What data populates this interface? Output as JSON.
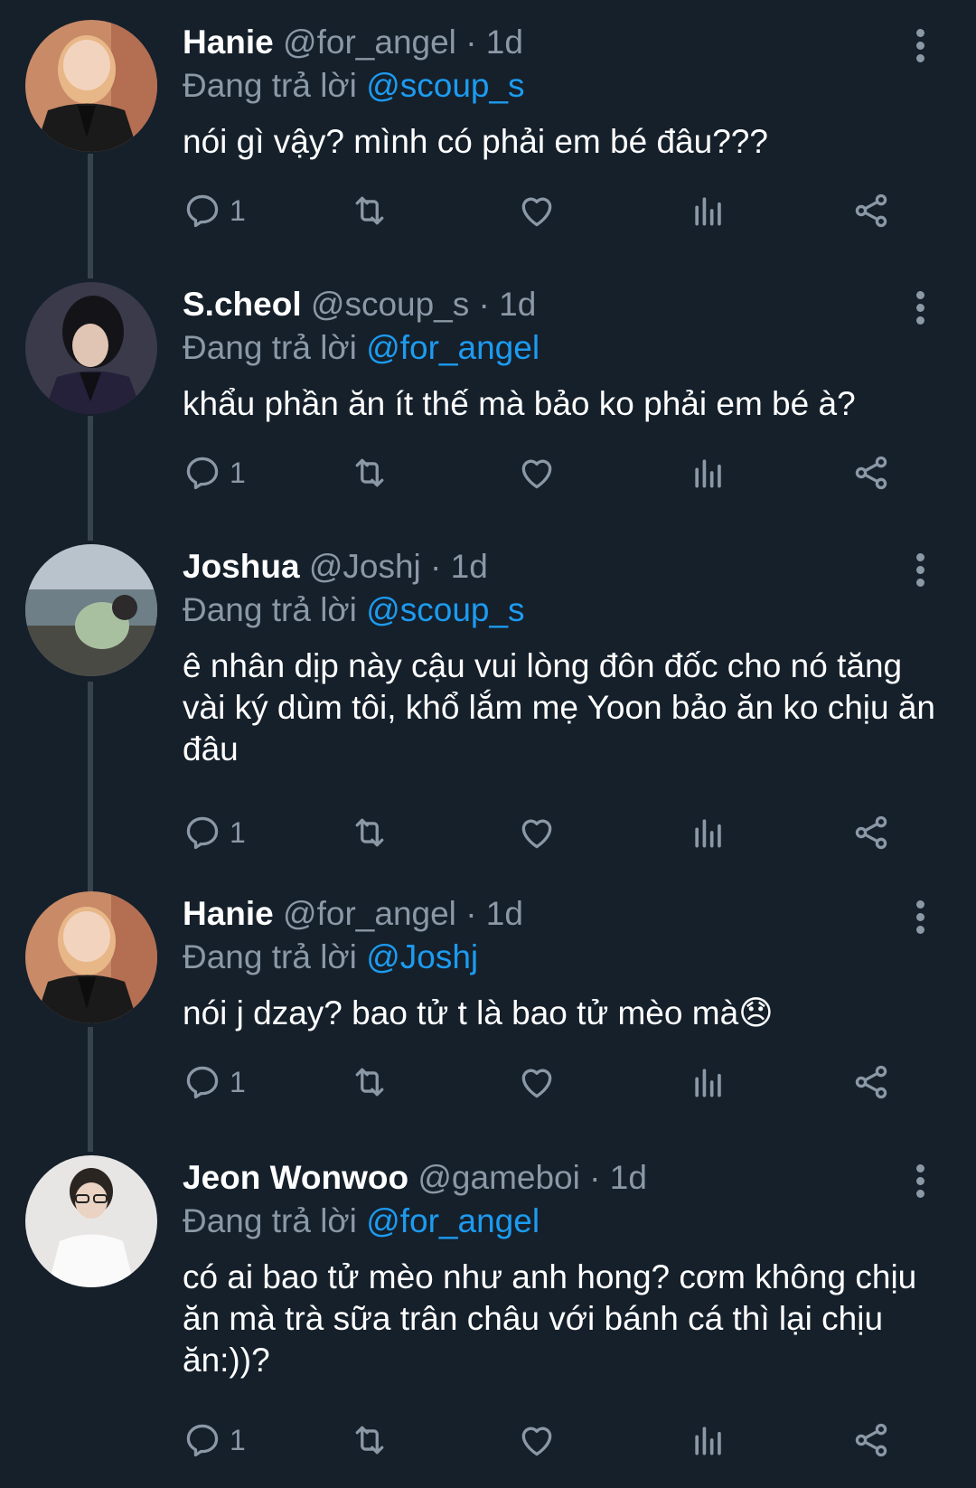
{
  "reply_prefix": "Đang trả lời",
  "colors": {
    "background": "#15202b",
    "mention": "#1d9bf0",
    "muted": "#8b98a5"
  },
  "tweets": [
    {
      "name": "Hanie",
      "handle": "@for_angel",
      "time": "1d",
      "replying_to": "@scoup_s",
      "text": "nói gì vậy? mình có phải em bé đâu???",
      "reply_count": "1"
    },
    {
      "name": "S.cheol",
      "handle": "@scoup_s",
      "time": "1d",
      "replying_to": "@for_angel",
      "text": "khẩu phần ăn ít thế mà bảo ko phải em bé à?",
      "reply_count": "1"
    },
    {
      "name": "Joshua",
      "handle": "@Joshj",
      "time": "1d",
      "replying_to": "@scoup_s",
      "text": "ê nhân dịp này cậu vui lòng đôn đốc cho nó tăng vài ký dùm tôi, khổ lắm mẹ Yoon bảo ăn ko chịu ăn đâu",
      "reply_count": "1"
    },
    {
      "name": "Hanie",
      "handle": "@for_angel",
      "time": "1d",
      "replying_to": "@Joshj",
      "text": "nói j dzay? bao tử t là bao tử mèo mà😞",
      "reply_count": "1"
    },
    {
      "name": "Jeon Wonwoo",
      "handle": "@gameboi",
      "time": "1d",
      "replying_to": "@for_angel",
      "text": "có ai bao tử mèo như anh hong? cơm không chịu ăn mà trà sữa trân châu với bánh cá thì lại chịu ăn:))?",
      "reply_count": "1"
    }
  ]
}
